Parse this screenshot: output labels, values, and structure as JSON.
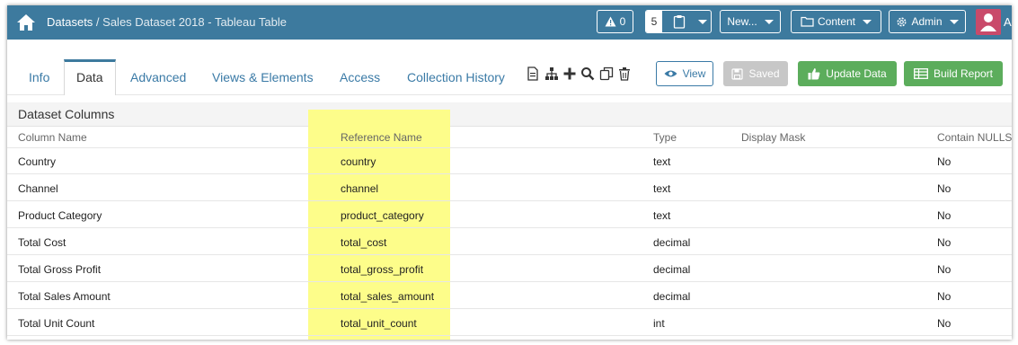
{
  "breadcrumb": {
    "root": "Datasets",
    "separator": " / ",
    "current": "Sales Dataset 2018 - Tableau Table"
  },
  "topbar": {
    "alerts_count": "0",
    "open_count": "5",
    "new_label": "New...",
    "content_label": "Content",
    "admin_label": "Admin",
    "user_initial": "A"
  },
  "tabs": [
    "Info",
    "Data",
    "Advanced",
    "Views & Elements",
    "Access",
    "Collection History"
  ],
  "active_tab": "Data",
  "toolbar_icons": [
    "document-icon",
    "sitemap-icon",
    "plus-icon",
    "search-icon",
    "copy-icon",
    "trash-icon"
  ],
  "buttons": {
    "view": "View",
    "saved": "Saved",
    "update": "Update Data",
    "build": "Build Report"
  },
  "colors": {
    "topbar": "#3d7a9e",
    "tab_text": "#3a7aa6",
    "green": "#5cad5c",
    "highlight": "#fdfd8a"
  },
  "table": {
    "section_title": "Dataset Columns",
    "columns": [
      "Column Name",
      "Reference Name",
      "Type",
      "Display Mask",
      "Contain NULLS"
    ],
    "rows": [
      {
        "name": "Country",
        "ref": "country",
        "type": "text",
        "mask": "",
        "nulls": "No"
      },
      {
        "name": "Channel",
        "ref": "channel",
        "type": "text",
        "mask": "",
        "nulls": "No"
      },
      {
        "name": "Product Category",
        "ref": "product_category",
        "type": "text",
        "mask": "",
        "nulls": "No"
      },
      {
        "name": "Total Cost",
        "ref": "total_cost",
        "type": "decimal",
        "mask": "",
        "nulls": "No"
      },
      {
        "name": "Total Gross Profit",
        "ref": "total_gross_profit",
        "type": "decimal",
        "mask": "",
        "nulls": "No"
      },
      {
        "name": "Total Sales Amount",
        "ref": "total_sales_amount",
        "type": "decimal",
        "mask": "",
        "nulls": "No"
      },
      {
        "name": "Total Unit Count",
        "ref": "total_unit_count",
        "type": "int",
        "mask": "",
        "nulls": "No"
      }
    ]
  }
}
